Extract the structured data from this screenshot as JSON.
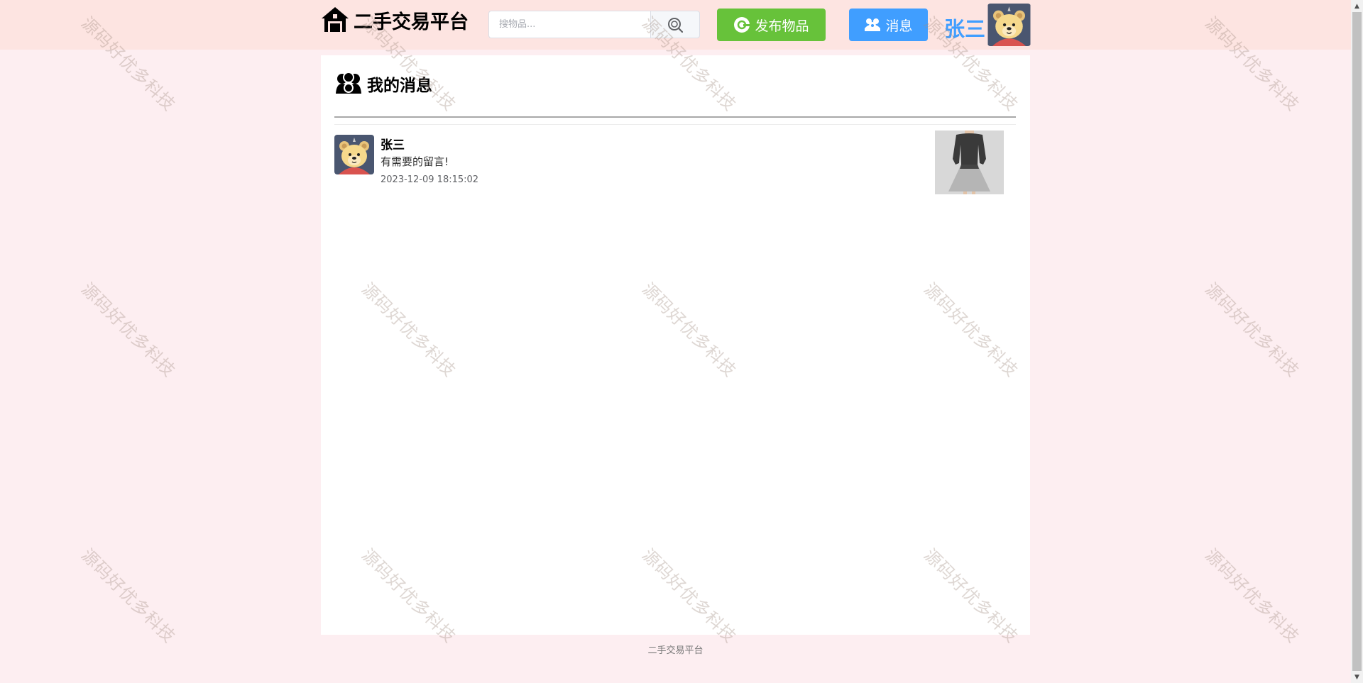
{
  "header": {
    "logo_text": "二手交易平台",
    "search_placeholder": "搜物品...",
    "publish_label": "发布物品",
    "message_label": "消息",
    "username": "张三"
  },
  "page": {
    "title": "我的消息"
  },
  "messages": [
    {
      "sender": "张三",
      "content": "有需要的留言!",
      "time": "2023-12-09 18:15:02"
    }
  ],
  "footer": {
    "text": "二手交易平台"
  },
  "watermark": {
    "text": "源码好优多科技"
  },
  "colors": {
    "header_bg": "#fde4e1",
    "page_bg": "#fdeef1",
    "publish_button": "#67c23a",
    "message_button": "#409eff",
    "username": "#409eff"
  },
  "icons": {
    "logo": "house-icon",
    "search": "search-icon",
    "publish": "plus-circle-icon",
    "message": "users-icon",
    "title": "users-icon"
  }
}
